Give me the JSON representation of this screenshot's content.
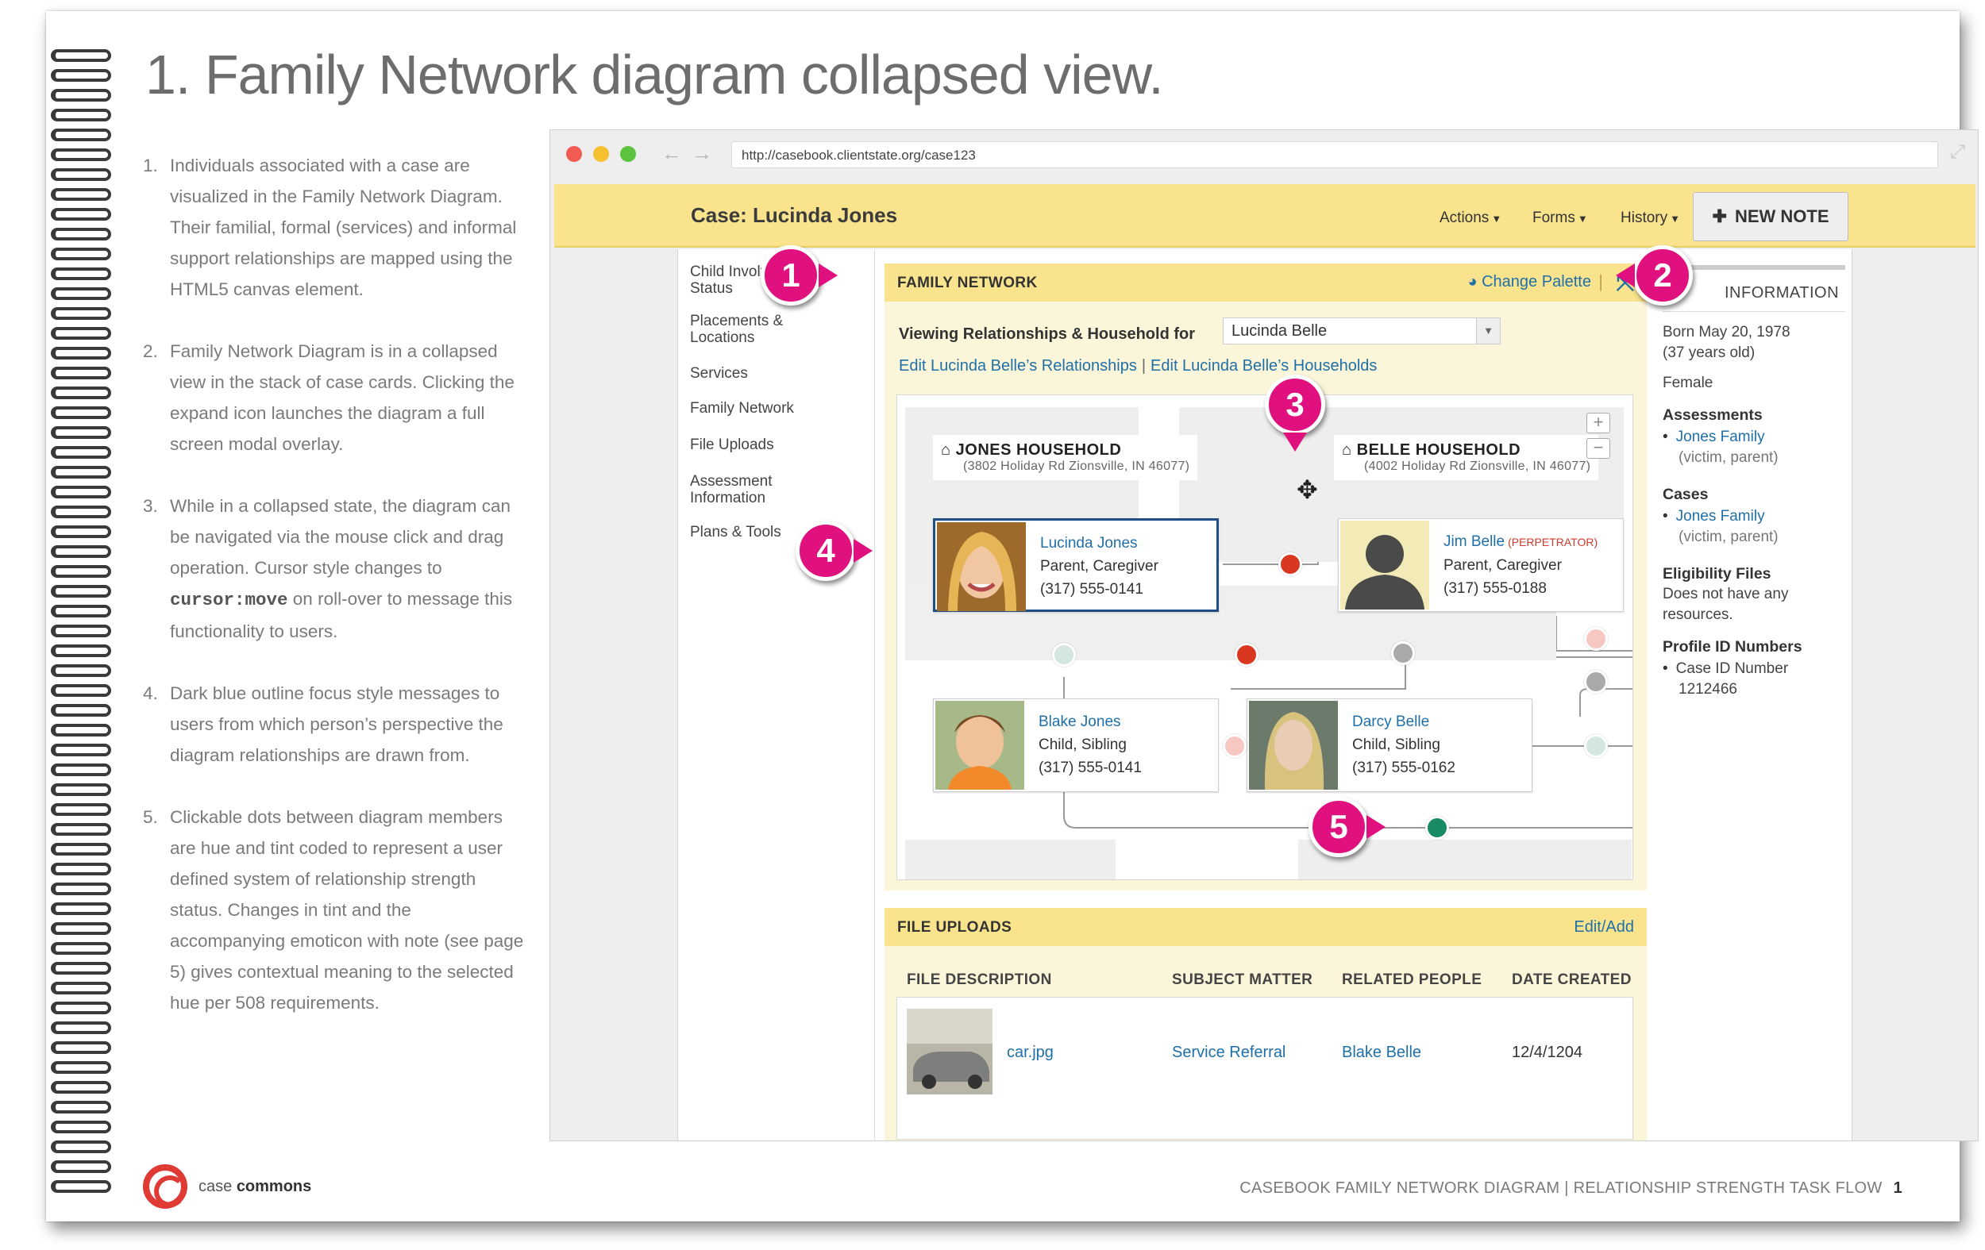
{
  "page": {
    "title": "1. Family Network diagram collapsed view.",
    "notes": [
      {
        "num": "1.",
        "text": "Individuals associated with a case are visualized in the Family Network Diagram. Their familial, formal (services) and informal support relationships are mapped using the HTML5 canvas element."
      },
      {
        "num": "2.",
        "text": "Family Network Diagram is in a collapsed view in the stack of case cards. Clicking the expand icon launches the diagram a full screen modal overlay."
      },
      {
        "num": "3.",
        "text_before": "While in a collapsed state, the diagram can be navigated via the mouse click and drag operation. Cursor style changes to",
        "code": "cursor:move",
        "text_after": "on roll-over to message this functionality to users."
      },
      {
        "num": "4.",
        "text": "Dark blue outline focus style messages to users from which person’s perspective the diagram relationships are drawn from."
      },
      {
        "num": "5.",
        "text": "Clickable dots between diagram members are hue and tint coded to represent a user defined system of relationship strength status. Changes in tint and the accompanying emoticon with note (see page 5) gives contextual meaning to the selected hue per 508 requirements."
      }
    ],
    "footer": {
      "logo_case": "case",
      "logo_commons": "commons",
      "caption": "CASEBOOK FAMILY NETWORK DIAGRAM | RELATIONSHIP STRENGTH TASK FLOW",
      "page_number": "1"
    }
  },
  "browser": {
    "url": "http://casebook.clientstate.org/case123",
    "traffic_lights": [
      "#f25b54",
      "#f7c030",
      "#5cc33f"
    ]
  },
  "app": {
    "case_title": "Case: Lucinda Jones",
    "menus": [
      "Actions",
      "Forms",
      "History"
    ],
    "new_note_label": "NEW NOTE",
    "accent_color": "#f9e48d",
    "link_color": "#1f6fa8",
    "left_nav": [
      "Child Involvement Status",
      "Placements & Locations",
      "Services",
      "Family Network",
      "File Uploads",
      "Assessment Information",
      "Plans & Tools"
    ]
  },
  "family_network": {
    "title": "FAMILY NETWORK",
    "change_palette": "Change Palette",
    "viewing_label": "Viewing Relationships & Household for",
    "viewing_value": "Lucinda Belle",
    "edit_relationships": "Edit Lucinda Belle’s Relationships",
    "edit_households": "Edit Lucinda Belle’s Households",
    "households": [
      {
        "name": "JONES HOUSEHOLD",
        "address": "(3802 Holiday Rd Zionsville, IN 46077)"
      },
      {
        "name": "BELLE HOUSEHOLD",
        "address": "(4002 Holiday Rd Zionsville, IN 46077)"
      }
    ],
    "people": [
      {
        "name": "Lucinda Jones",
        "role": "Parent, Caregiver",
        "phone": "(317) 555-0141",
        "tag": ""
      },
      {
        "name": "Jim Belle",
        "role": "Parent, Caregiver",
        "phone": "(317) 555-0188",
        "tag": "(PERPETRATOR)"
      },
      {
        "name": "Blake Jones",
        "role": "Child, Sibling",
        "phone": "(317) 555-0141",
        "tag": ""
      },
      {
        "name": "Darcy Belle",
        "role": "Child, Sibling",
        "phone": "(317) 555-0162",
        "tag": ""
      }
    ],
    "dot_colors": {
      "red": "#d9371f",
      "pale_green": "#d3e7df",
      "pale_red": "#f7c7c2",
      "grey": "#a9a9a9",
      "dark_green": "#188a64"
    }
  },
  "file_uploads": {
    "title": "FILE UPLOADS",
    "edit_add": "Edit/Add",
    "columns": [
      "FILE DESCRIPTION",
      "SUBJECT MATTER",
      "RELATED PEOPLE",
      "DATE CREATED"
    ],
    "rows": [
      {
        "file": "car.jpg",
        "subject": "Service Referral",
        "people": "Blake Belle",
        "date": "12/4/1204"
      }
    ]
  },
  "right_info": {
    "title": "INFORMATION",
    "born": "Born May 20, 1978",
    "age": "(37 years old)",
    "gender": "Female",
    "assessments_label": "Assessments",
    "assessment_link": "Jones Family",
    "assessment_sub": "(victim, parent)",
    "cases_label": "Cases",
    "case_link": "Jones Family",
    "case_sub": "(victim, parent)",
    "eligibility_label": "Eligibility Files",
    "eligibility_text": "Does not have any resources.",
    "profile_label": "Profile ID Numbers",
    "profile_item": "Case ID Number",
    "profile_value": "1212466"
  },
  "callouts": [
    "1",
    "2",
    "3",
    "4",
    "5"
  ]
}
